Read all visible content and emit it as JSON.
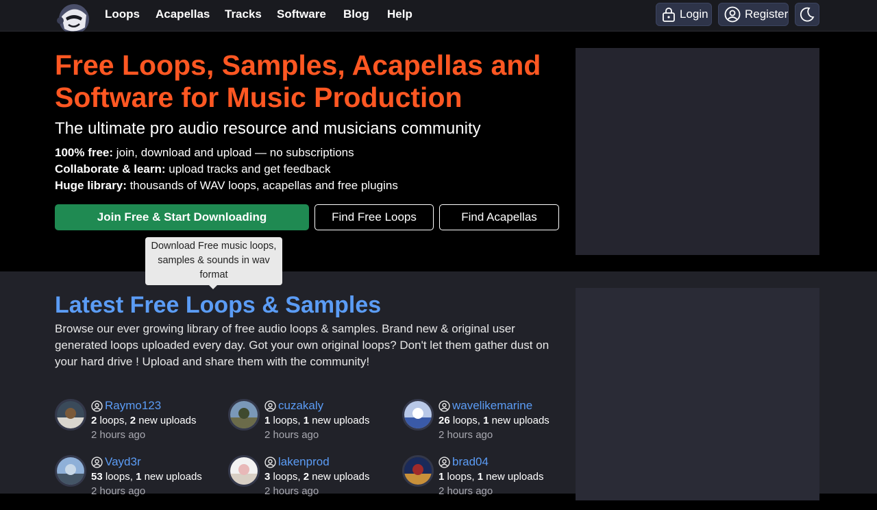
{
  "nav": {
    "links": [
      "Loops",
      "Acapellas",
      "Tracks",
      "Software",
      "Blog",
      "Help"
    ],
    "login": "Login",
    "register": "Register"
  },
  "hero": {
    "title": "Free Loops, Samples, Acapellas and Software for Music Production",
    "subtitle": "The ultimate pro audio resource and musicians community",
    "points": [
      {
        "bold": "100% free:",
        "text": " join, download and upload — no subscriptions"
      },
      {
        "bold": "Collaborate & learn:",
        "text": " upload tracks and get feedback"
      },
      {
        "bold": "Huge library:",
        "text": " thousands of WAV loops, acapellas and free plugins"
      }
    ],
    "join_button": "Join Free & Start Downloading",
    "loops_button": "Find Free Loops",
    "acapellas_button": "Find Acapellas"
  },
  "tooltip": "Download Free music loops, samples & sounds in wav format",
  "latest": {
    "title": "Latest Free Loops & Samples",
    "description": "Browse our ever growing library of free audio loops & samples. Brand new & original user generated loops uploaded every day. Got your own original loops? Don't let them gather dust on your hard drive ! Upload and share them with the community!",
    "users": [
      {
        "name": "Raymo123",
        "loops": "2",
        "uploads": "2",
        "time": "2 hours ago"
      },
      {
        "name": "cuzakaly",
        "loops": "1",
        "uploads": "1",
        "time": "2 hours ago"
      },
      {
        "name": "wavelikemarine",
        "loops": "26",
        "uploads": "1",
        "time": "2 hours ago"
      },
      {
        "name": "Vayd3r",
        "loops": "53",
        "uploads": "1",
        "time": "2 hours ago"
      },
      {
        "name": "lakenprod",
        "loops": "3",
        "uploads": "2",
        "time": "2 hours ago"
      },
      {
        "name": "brad04",
        "loops": "1",
        "uploads": "1",
        "time": "2 hours ago"
      }
    ],
    "loops_word": " loops, ",
    "uploads_word": " new uploads"
  },
  "colors": {
    "accent": "#ff5722",
    "link": "#5b9cf5",
    "join": "#1f8a52"
  }
}
